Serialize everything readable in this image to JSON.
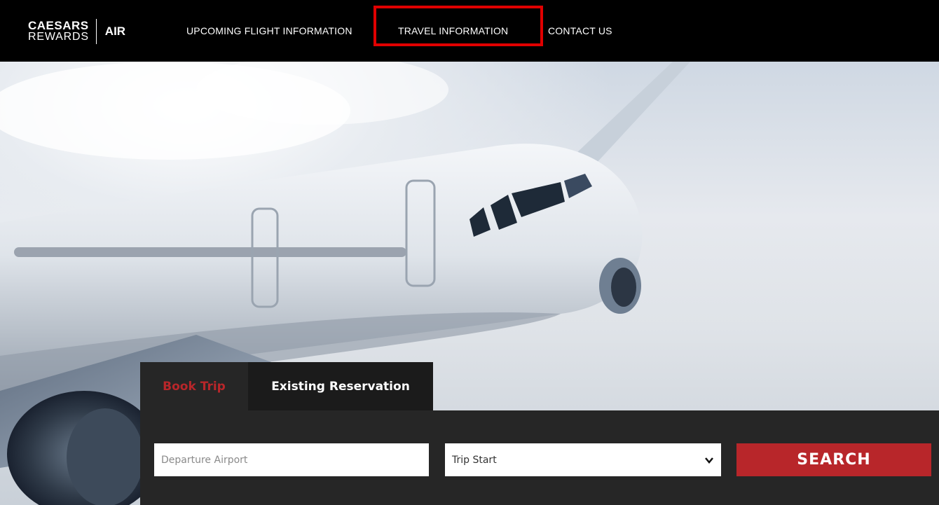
{
  "logo": {
    "line1": "CAESARS",
    "line2": "REWARDS",
    "air": "AIR"
  },
  "nav": {
    "items": [
      {
        "label": "UPCOMING FLIGHT INFORMATION"
      },
      {
        "label": "TRAVEL INFORMATION"
      },
      {
        "label": "CONTACT US"
      }
    ],
    "highlight_color": "#e00000"
  },
  "booking": {
    "tabs": [
      {
        "label": "Book Trip",
        "active": true
      },
      {
        "label": "Existing Reservation",
        "active": false
      }
    ],
    "departure": {
      "placeholder": "Departure Airport",
      "value": ""
    },
    "trip_start": {
      "selected": "Trip Start"
    },
    "search_label": "SEARCH"
  },
  "colors": {
    "accent": "#b8262a",
    "topbar": "#000000",
    "panel": "#262626"
  },
  "icons": {
    "dropdown": "chevron-down-icon"
  }
}
